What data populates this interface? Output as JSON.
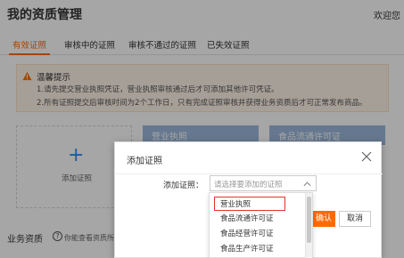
{
  "header": {
    "title": "我的资质管理",
    "welcome": "欢迎您"
  },
  "tabs": [
    {
      "label": "有效证照",
      "active": true
    },
    {
      "label": "审核中的证照",
      "active": false
    },
    {
      "label": "审核不通过的证照",
      "active": false
    },
    {
      "label": "已失效证照",
      "active": false
    }
  ],
  "notice": {
    "title": "温馨提示",
    "lines": [
      "1.请先提交营业执照凭证，营业执照审核通过后才可添加其他许可凭证。",
      "2.所有证照提交后审核时间为2个工作日，只有完成证照审核并获得业务资质后才可正常发布商品。"
    ],
    "icon": "warning-icon",
    "color": "#ff6a00"
  },
  "cards": {
    "add_label": "添加证照",
    "business_license": "营业执照",
    "food_circulation": "食品流通许可证"
  },
  "section": {
    "title": "业务资质",
    "help_text": "你能查看资质所需..."
  },
  "modal": {
    "title": "添加证照",
    "field_label": "添加证照：",
    "placeholder": "请选择要添加的证照",
    "options": [
      "营业执照",
      "食品流通许可证",
      "食品经营许可证",
      "食品生产许可证"
    ],
    "selected_option": "营业执照",
    "confirm_label": "确认",
    "cancel_label": "取消"
  },
  "colors": {
    "accent": "#ff6a00",
    "card_header": "#9bb9dc",
    "highlight_border": "#e5322d"
  }
}
